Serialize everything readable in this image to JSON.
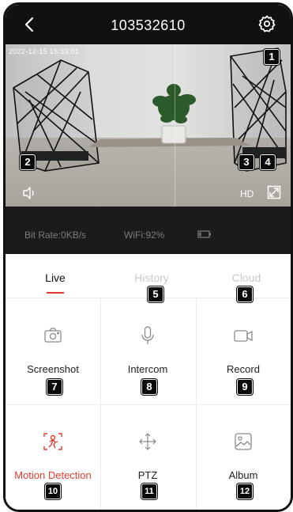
{
  "header": {
    "title": "103532610",
    "back_icon": "back-chevron-icon",
    "settings_icon": "gear-icon"
  },
  "video": {
    "timestamp": "2022-12-15 15:33:01",
    "quality_label": "HD",
    "speaker_icon": "speaker-icon",
    "fullscreen_icon": "fullscreen-icon"
  },
  "stats": {
    "bitrate": "Bit Rate:0KB/s",
    "wifi": "WiFi:92%",
    "battery_icon": "battery-icon"
  },
  "tabs": [
    {
      "label": "Live",
      "active": true
    },
    {
      "label": "History",
      "active": false
    },
    {
      "label": "Cloud",
      "active": false
    }
  ],
  "actions": [
    {
      "label": "Screenshot",
      "icon": "camera-icon"
    },
    {
      "label": "Intercom",
      "icon": "microphone-icon"
    },
    {
      "label": "Record",
      "icon": "video-camera-icon"
    },
    {
      "label": "Motion Detection",
      "icon": "motion-person-icon"
    },
    {
      "label": "PTZ",
      "icon": "ptz-arrows-icon"
    },
    {
      "label": "Album",
      "icon": "image-icon"
    }
  ],
  "callouts": [
    "1",
    "2",
    "3",
    "4",
    "5",
    "6",
    "7",
    "8",
    "9",
    "10",
    "11",
    "12"
  ],
  "colors": {
    "accent": "#e23b2f",
    "dark": "#111111",
    "stats_bg": "#1b1b1b"
  }
}
